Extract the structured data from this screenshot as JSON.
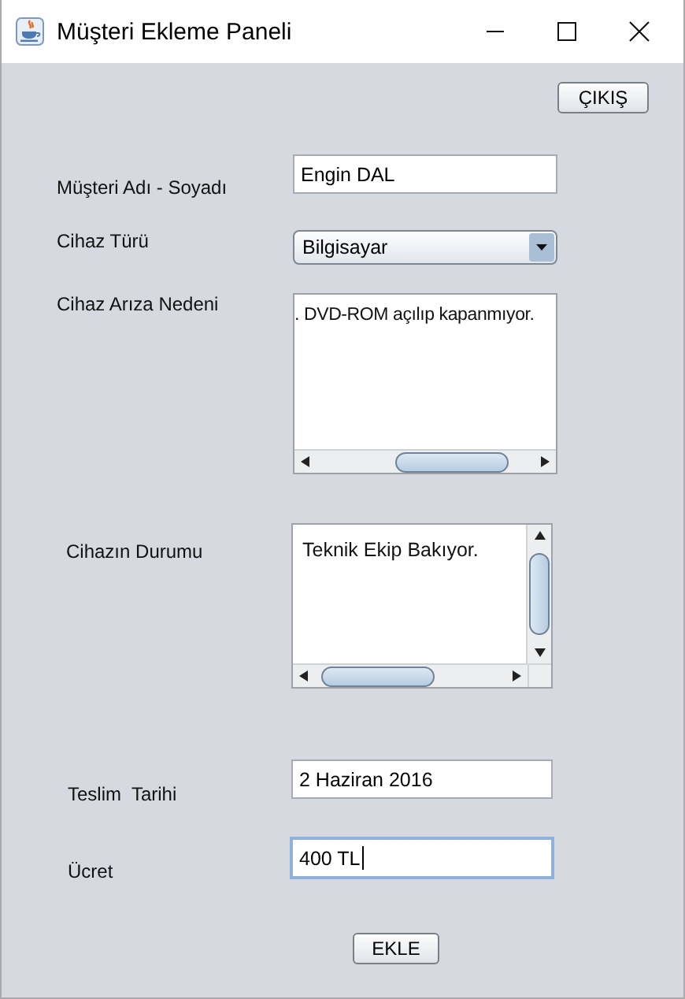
{
  "window": {
    "title": "Müşteri Ekleme Paneli"
  },
  "exit_button": "ÇIKIŞ",
  "fields": [
    {
      "kind": "text",
      "label": "Müşteri Adı - Soyadı",
      "value": "Engin DAL",
      "focused": false
    },
    {
      "kind": "combo",
      "label": "Cihaz Türü",
      "value": "Bilgisayar"
    },
    {
      "kind": "hscroll_area",
      "label": "Cihaz Arıza Nedeni",
      "value": ". DVD-ROM açılıp kapanmıyor."
    },
    {
      "kind": "scroll_area",
      "label": "Cihazın Durumu",
      "value": "Teknik Ekip Bakıyor."
    },
    {
      "kind": "text",
      "label": "Teslim  Tarihi",
      "value": "2 Haziran 2016",
      "focused": false
    },
    {
      "kind": "text",
      "label": "Ücret",
      "value": "400 TL",
      "focused": true
    }
  ],
  "add_button": "EKLE"
}
